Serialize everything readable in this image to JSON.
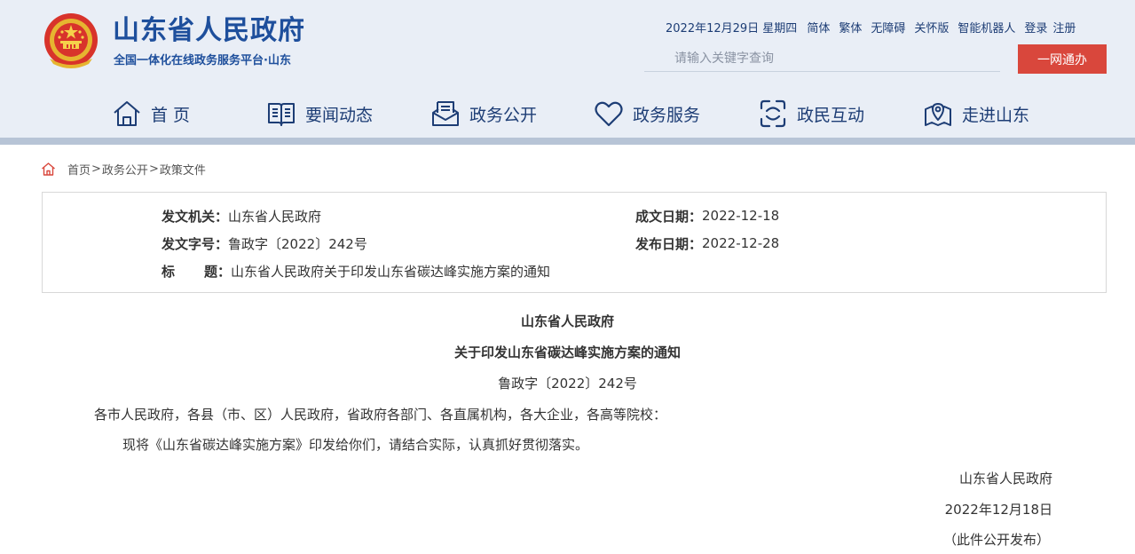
{
  "header": {
    "title": "山东省人民政府",
    "subtitle": "全国一体化在线政务服务平台·山东",
    "date": "2022年12月29日 星期四",
    "links": [
      "简体",
      "繁体",
      "无障碍",
      "关怀版",
      "智能机器人",
      "登录",
      "注册"
    ],
    "search": {
      "placeholder": "请输入关键字查询",
      "button": "一网通办"
    },
    "nav": [
      {
        "label": "首 页",
        "icon": "home-icon"
      },
      {
        "label": "要闻动态",
        "icon": "newspaper-icon"
      },
      {
        "label": "政务公开",
        "icon": "mail-tray-icon"
      },
      {
        "label": "政务服务",
        "icon": "heart-icon"
      },
      {
        "label": "政民互动",
        "icon": "interaction-icon"
      },
      {
        "label": "走进山东",
        "icon": "map-pin-icon"
      }
    ]
  },
  "breadcrumb": {
    "icon": "home-icon",
    "items": [
      "首页",
      "政务公开",
      "政策文件"
    ],
    "separator": ">"
  },
  "info": {
    "issuer_label": "发文机关：",
    "issuer": "山东省人民政府",
    "doc_no_label": "发文字号：",
    "doc_no": "鲁政字〔2022〕242号",
    "title_label_1": "标",
    "title_label_2": "题：",
    "title": "山东省人民政府关于印发山东省碳达峰实施方案的通知",
    "created_label": "成文日期：",
    "created": "2022-12-18",
    "published_label": "发布日期：",
    "published": "2022-12-28"
  },
  "article": {
    "heading_1": "山东省人民政府",
    "heading_2": "关于印发山东省碳达峰实施方案的通知",
    "doc_no": "鲁政字〔2022〕242号",
    "addressee": "各市人民政府，各县（市、区）人民政府，省政府各部门、各直属机构，各大企业，各高等院校：",
    "body": "现将《山东省碳达峰实施方案》印发给你们，请结合实际，认真抓好贯彻落实。",
    "sign_org": "山东省人民政府",
    "sign_date": "2022年12月18日",
    "note": "（此件公开发布）"
  },
  "colors": {
    "brand_blue": "#1e4f9c",
    "button_red": "#d9473c",
    "header_bg": "#e9eef6"
  }
}
